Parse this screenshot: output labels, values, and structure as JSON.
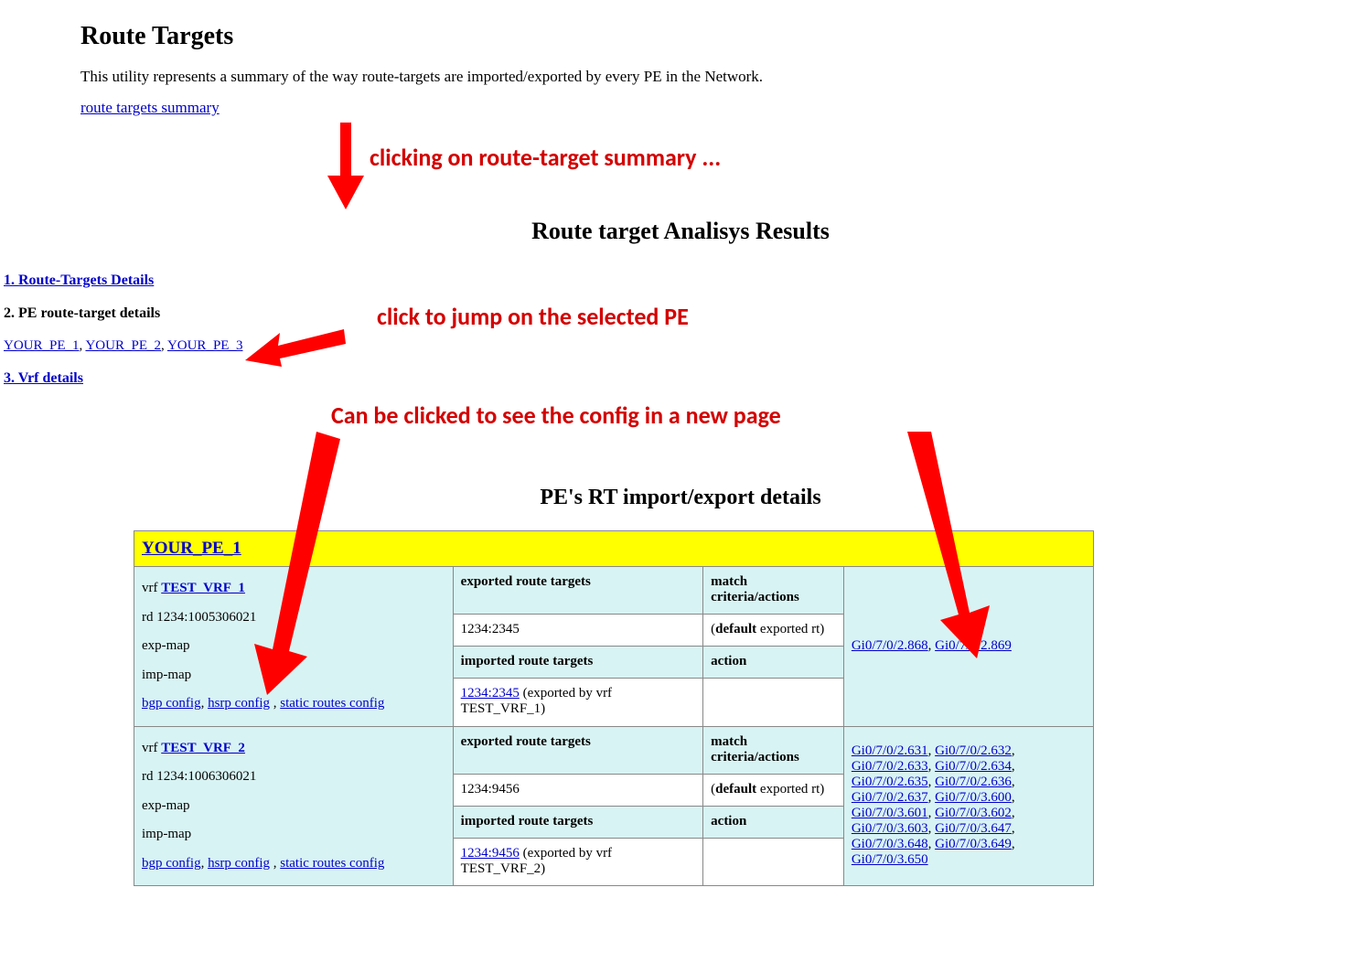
{
  "header": {
    "title": "Route Targets",
    "intro": "This utility represents a summary of the way route-targets are imported/exported by every PE in the Network.",
    "summary_link": "route targets summary"
  },
  "annotations": {
    "a1": "clicking on route-target summary ...",
    "a2": "click to jump on the selected PE",
    "a3": "Can be clicked to see the config in a new page"
  },
  "section_title": "Route target Analisys Results",
  "nav": {
    "item1": "1. Route-Targets Details",
    "item2": "2. PE route-target details",
    "pe_links": [
      "YOUR_PE_1",
      "YOUR_PE_2",
      "YOUR_PE_3"
    ],
    "item3": "3. Vrf details"
  },
  "details_title": "PE's RT import/export details",
  "pe_header_link": "YOUR_PE_1",
  "table": {
    "col_hdr_exp": "exported route targets",
    "col_hdr_match": "match criteria/actions",
    "col_hdr_imp": "imported route targets",
    "col_hdr_action": "action",
    "default_exp": "default",
    "default_exp_suffix": " exported rt)",
    "cfg_links": {
      "bgp": "bgp config",
      "hsrp": "hsrp config",
      "static": "static routes config"
    },
    "vrf_labels": {
      "vrf": "vrf ",
      "rd": "rd ",
      "expmap": "exp-map",
      "impmap": "imp-map"
    },
    "rows": [
      {
        "vrf_name": "TEST_VRF_1",
        "rd": "1234:1005306021",
        "exp_rt": "1234:2345",
        "imp_rt_link": "1234:2345",
        "imp_rt_suffix": " (exported by vrf TEST_VRF_1)",
        "ifaces": [
          "Gi0/7/0/2.868",
          "Gi0/7/0/2.869"
        ]
      },
      {
        "vrf_name": "TEST_VRF_2",
        "rd": "1234:1006306021",
        "exp_rt": "1234:9456",
        "imp_rt_link": "1234:9456",
        "imp_rt_suffix": " (exported by vrf TEST_VRF_2)",
        "ifaces": [
          "Gi0/7/0/2.631",
          "Gi0/7/0/2.632",
          "Gi0/7/0/2.633",
          "Gi0/7/0/2.634",
          "Gi0/7/0/2.635",
          "Gi0/7/0/2.636",
          "Gi0/7/0/2.637",
          "Gi0/7/0/3.600",
          "Gi0/7/0/3.601",
          "Gi0/7/0/3.602",
          "Gi0/7/0/3.603",
          "Gi0/7/0/3.647",
          "Gi0/7/0/3.648",
          "Gi0/7/0/3.649",
          "Gi0/7/0/3.650"
        ]
      }
    ]
  }
}
